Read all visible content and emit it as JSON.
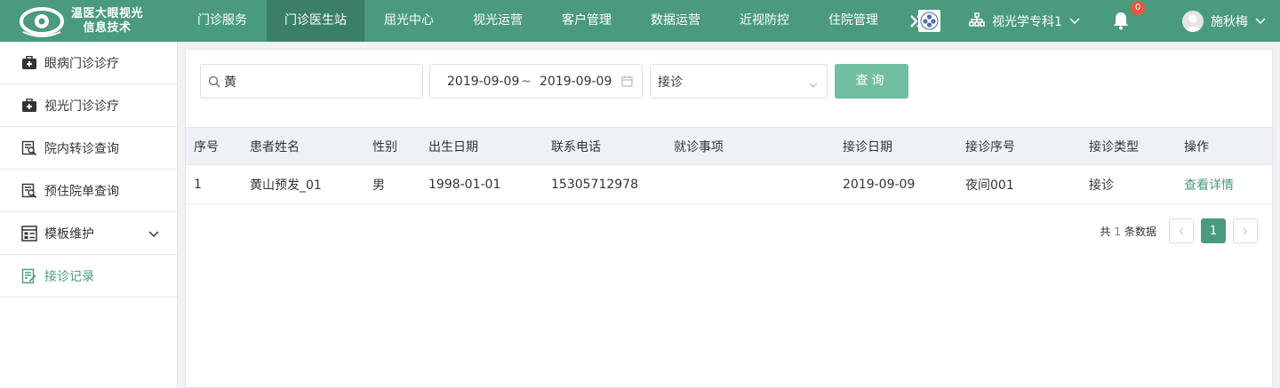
{
  "brand": {
    "line1": "温医大眼视光",
    "line2": "信息技术"
  },
  "nav": {
    "items": [
      {
        "label": "门诊服务",
        "active": false
      },
      {
        "label": "门诊医生站",
        "active": true
      },
      {
        "label": "屈光中心",
        "active": false
      },
      {
        "label": "视光运营",
        "active": false
      },
      {
        "label": "客户管理",
        "active": false
      },
      {
        "label": "数据运营",
        "active": false
      },
      {
        "label": "近视防控",
        "active": false
      },
      {
        "label": "住院管理",
        "active": false
      }
    ],
    "more_icon": "double-chevron-right-icon"
  },
  "header": {
    "department": "视光学专科1",
    "notification_count": "0",
    "user_name": "施秋梅"
  },
  "sidebar": {
    "items": [
      {
        "label": "眼病门诊诊疗",
        "icon": "medical-kit-icon"
      },
      {
        "label": "视光门诊诊疗",
        "icon": "medical-kit-icon"
      },
      {
        "label": "院内转诊查询",
        "icon": "search-document-icon"
      },
      {
        "label": "预住院单查询",
        "icon": "search-document-icon"
      },
      {
        "label": "模板维护",
        "icon": "template-icon",
        "has_submenu": true
      },
      {
        "label": "接诊记录",
        "icon": "edit-document-icon",
        "active": true
      }
    ]
  },
  "filters": {
    "search_value": "黄",
    "date_start": "2019-09-09",
    "date_sep": "~",
    "date_end": "2019-09-09",
    "type_selected": "接诊",
    "query_label": "查询"
  },
  "table": {
    "columns": [
      "序号",
      "患者姓名",
      "性别",
      "出生日期",
      "联系电话",
      "就诊事项",
      "接诊日期",
      "接诊序号",
      "接诊类型",
      "操作"
    ],
    "rows": [
      {
        "index": "1",
        "name": "黄山预发_01",
        "gender": "男",
        "birth": "1998-01-01",
        "phone": "15305712978",
        "matter": "",
        "visit_date": "2019-09-09",
        "visit_no": "夜间001",
        "visit_type": "接诊",
        "action": "查看详情"
      }
    ]
  },
  "pagination": {
    "prefix": "共",
    "total": "1",
    "suffix": "条数据",
    "current_page": "1"
  },
  "colors": {
    "primary": "#4a9a7e",
    "nav_active": "#3a7f66",
    "button": "#72bea0",
    "badge": "#e8563f"
  }
}
